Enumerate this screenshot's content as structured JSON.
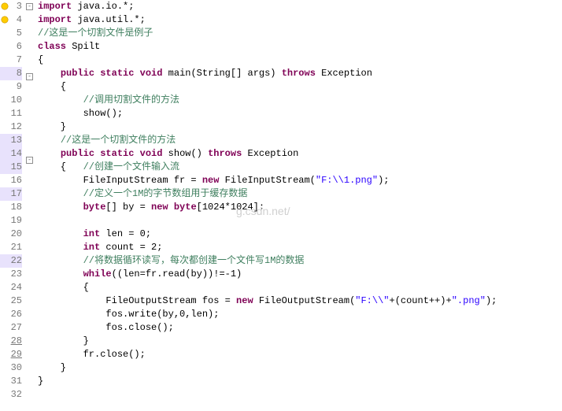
{
  "watermark": "g.csdn.net/",
  "gutter": [
    {
      "n": "3",
      "fold": "-",
      "icon": "warning"
    },
    {
      "n": "4",
      "icon": "warning"
    },
    {
      "n": "5"
    },
    {
      "n": "6"
    },
    {
      "n": "7"
    },
    {
      "n": "8",
      "fold": "-",
      "hl": true,
      "icon": "run"
    },
    {
      "n": "9"
    },
    {
      "n": "10"
    },
    {
      "n": "11"
    },
    {
      "n": "12"
    },
    {
      "n": "13",
      "hl": true
    },
    {
      "n": "14",
      "fold": "-",
      "hl": true,
      "icon": "run"
    },
    {
      "n": "15",
      "hl": true
    },
    {
      "n": "16"
    },
    {
      "n": "17",
      "hl": true
    },
    {
      "n": "18"
    },
    {
      "n": "19"
    },
    {
      "n": "20"
    },
    {
      "n": "21"
    },
    {
      "n": "22",
      "hl": true
    },
    {
      "n": "23"
    },
    {
      "n": "24"
    },
    {
      "n": "25"
    },
    {
      "n": "26"
    },
    {
      "n": "27"
    },
    {
      "n": "28",
      "ul": true
    },
    {
      "n": "29",
      "ul": true
    },
    {
      "n": "30"
    },
    {
      "n": "31"
    },
    {
      "n": "32"
    }
  ],
  "code": [
    [
      [
        "kw",
        "import"
      ],
      [
        "txt",
        " java.io.*;"
      ]
    ],
    [
      [
        "kw",
        "import"
      ],
      [
        "txt",
        " java.util.*;"
      ]
    ],
    [
      [
        "com",
        "//这是一个切割文件是例子"
      ]
    ],
    [
      [
        "kw",
        "class"
      ],
      [
        "txt",
        " Spilt"
      ]
    ],
    [
      [
        "txt",
        "{"
      ]
    ],
    [
      [
        "txt",
        "    "
      ],
      [
        "kw",
        "public"
      ],
      [
        "txt",
        " "
      ],
      [
        "kw",
        "static"
      ],
      [
        "txt",
        " "
      ],
      [
        "kw",
        "void"
      ],
      [
        "txt",
        " main(String[] args) "
      ],
      [
        "kw",
        "throws"
      ],
      [
        "txt",
        " Exception"
      ]
    ],
    [
      [
        "txt",
        "    {"
      ]
    ],
    [
      [
        "txt",
        "        "
      ],
      [
        "com",
        "//调用切割文件的方法"
      ]
    ],
    [
      [
        "txt",
        "        "
      ],
      [
        "txt",
        "show"
      ],
      [
        "txt",
        "();"
      ]
    ],
    [
      [
        "txt",
        "    }"
      ]
    ],
    [
      [
        "txt",
        "    "
      ],
      [
        "com",
        "//这是一个切割文件的方法"
      ]
    ],
    [
      [
        "txt",
        "    "
      ],
      [
        "kw",
        "public"
      ],
      [
        "txt",
        " "
      ],
      [
        "kw",
        "static"
      ],
      [
        "txt",
        " "
      ],
      [
        "kw",
        "void"
      ],
      [
        "txt",
        " show() "
      ],
      [
        "kw",
        "throws"
      ],
      [
        "txt",
        " Exception"
      ]
    ],
    [
      [
        "txt",
        "    {   "
      ],
      [
        "com",
        "//创建一个文件输入流"
      ]
    ],
    [
      [
        "txt",
        "        FileInputStream fr = "
      ],
      [
        "kw",
        "new"
      ],
      [
        "txt",
        " FileInputStream("
      ],
      [
        "str",
        "\"F:\\\\1.png\""
      ],
      [
        "txt",
        ");"
      ]
    ],
    [
      [
        "txt",
        "        "
      ],
      [
        "com",
        "//定义一个1M的字节数组用于缓存数据"
      ]
    ],
    [
      [
        "txt",
        "        "
      ],
      [
        "kw",
        "byte"
      ],
      [
        "txt",
        "[] by = "
      ],
      [
        "kw",
        "new"
      ],
      [
        "txt",
        " "
      ],
      [
        "kw",
        "byte"
      ],
      [
        "txt",
        "[1024*1024];"
      ]
    ],
    [],
    [
      [
        "txt",
        "        "
      ],
      [
        "kw",
        "int"
      ],
      [
        "txt",
        " len = 0;"
      ]
    ],
    [
      [
        "txt",
        "        "
      ],
      [
        "kw",
        "int"
      ],
      [
        "txt",
        " count = 2;"
      ]
    ],
    [
      [
        "txt",
        "        "
      ],
      [
        "com",
        "//将数据循环读写，每次都创建一个文件写1M的数据"
      ]
    ],
    [
      [
        "txt",
        "        "
      ],
      [
        "kw",
        "while"
      ],
      [
        "txt",
        "((len=fr.read(by))!=-1)"
      ]
    ],
    [
      [
        "txt",
        "        {"
      ]
    ],
    [
      [
        "txt",
        "            FileOutputStream fos = "
      ],
      [
        "kw",
        "new"
      ],
      [
        "txt",
        " FileOutputStream("
      ],
      [
        "str",
        "\"F:\\\\\""
      ],
      [
        "txt",
        "+(count++)+"
      ],
      [
        "str",
        "\".png\""
      ],
      [
        "txt",
        ");"
      ]
    ],
    [
      [
        "txt",
        "            fos.write(by,0,len);"
      ]
    ],
    [
      [
        "txt",
        "            fos.close();"
      ]
    ],
    [
      [
        "txt",
        "        }"
      ]
    ],
    [
      [
        "txt",
        "        fr.close();"
      ]
    ],
    [
      [
        "txt",
        "    }"
      ]
    ],
    [
      [
        "txt",
        "}"
      ]
    ],
    []
  ]
}
